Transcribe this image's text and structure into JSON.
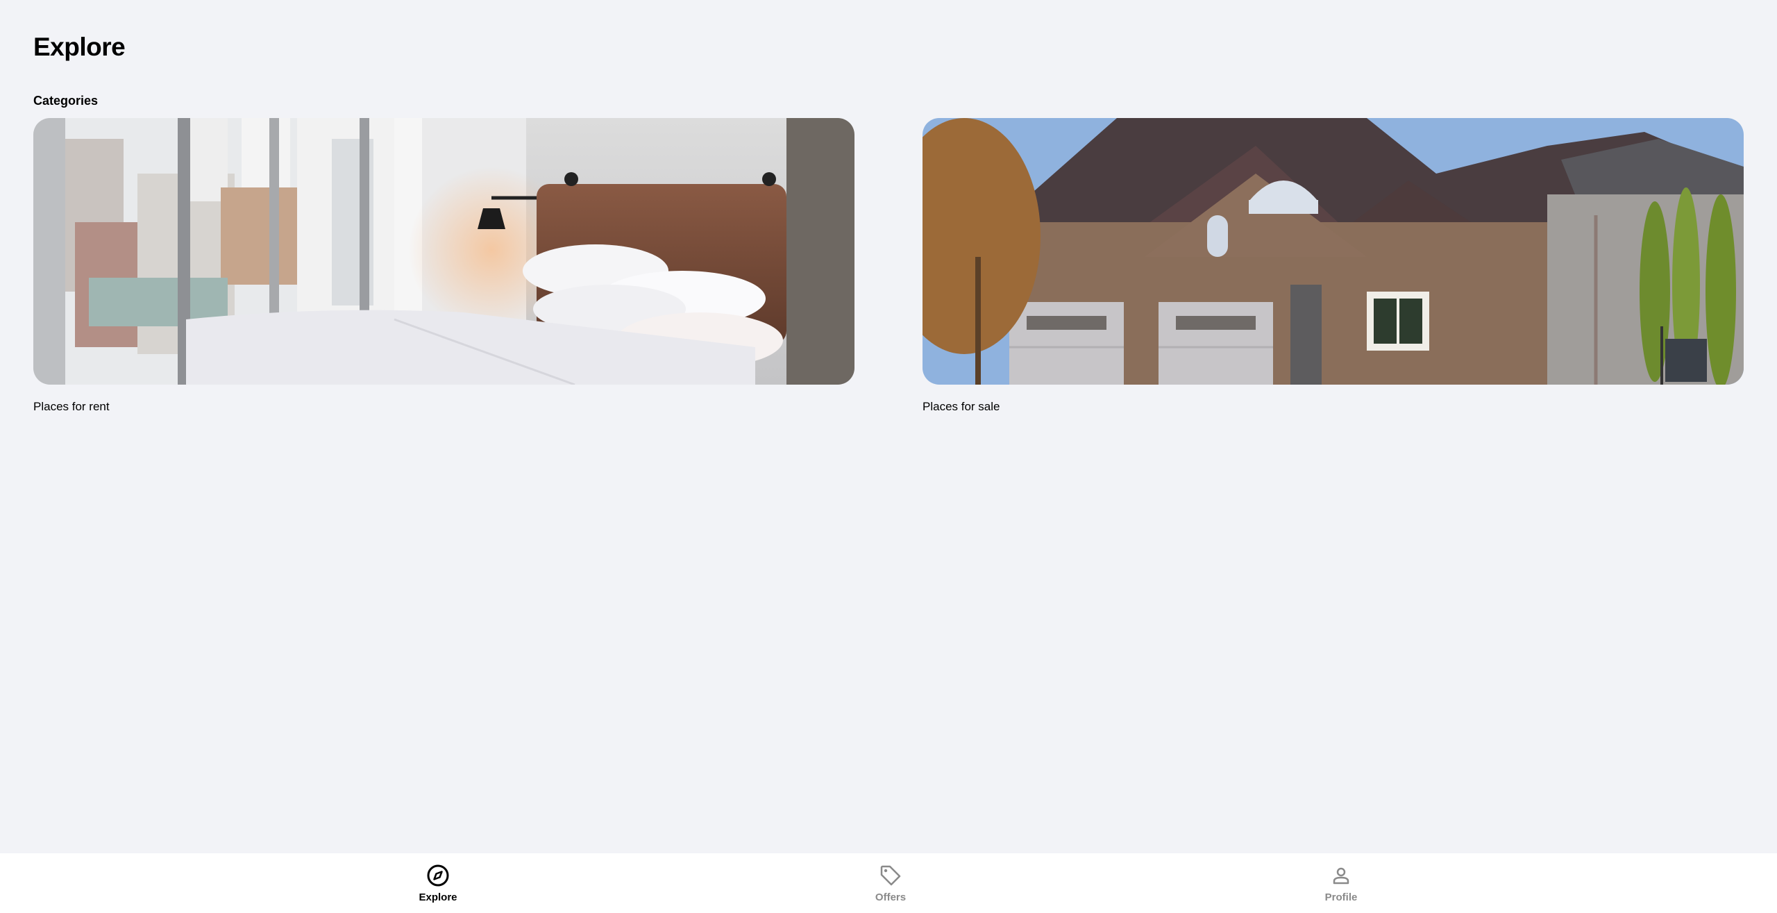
{
  "header": {
    "title": "Explore"
  },
  "categories": {
    "heading": "Categories",
    "items": [
      {
        "label": "Places for rent",
        "image": "bedroom-photo"
      },
      {
        "label": "Places for sale",
        "image": "house-photo"
      }
    ]
  },
  "bottom_nav": {
    "items": [
      {
        "label": "Explore",
        "icon": "compass-icon",
        "active": true
      },
      {
        "label": "Offers",
        "icon": "tag-icon",
        "active": false
      },
      {
        "label": "Profile",
        "icon": "person-icon",
        "active": false
      }
    ]
  },
  "colors": {
    "background": "#f2f3f7",
    "nav_background": "#ffffff",
    "active": "#000000",
    "inactive": "#8a8a8a"
  }
}
